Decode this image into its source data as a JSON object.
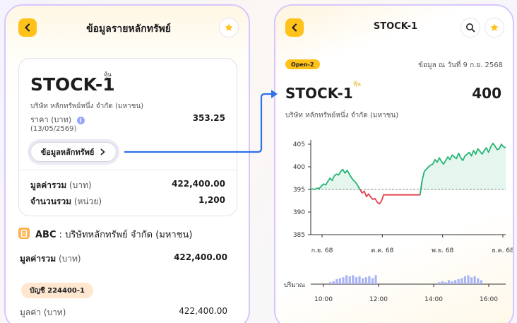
{
  "left_screen": {
    "title": "ข้อมูลรายหลักทรัพย์",
    "stock": {
      "symbol": "STOCK-1",
      "unit_sup": "หุ้น",
      "company": "บริษัท หลักทรัพย์หนึ่ง จำกัด (มหาชน)",
      "price_label": "ราคา (บาท)",
      "price_value": "353.25",
      "price_date": "(13/05/2569)",
      "info_button": "ข้อมูลหลักทรัพย์"
    },
    "totals": {
      "value_label_bold": "มูลค่ารวม",
      "value_label_unit": "(บาท)",
      "value": "422,400.00",
      "qty_label_bold": "จำนวนรวม",
      "qty_label_unit": "(หน่วย)",
      "qty": "1,200"
    },
    "broker": {
      "code": "ABC",
      "separator": ":",
      "name": "บริษัทหลักทรัพย์ จำกัด (มหาชน)",
      "value_label_bold": "มูลค่ารวม",
      "value_label_unit": "(บาท)",
      "value": "422,400.00"
    },
    "account": {
      "badge": "บัญชี 224400-1",
      "value_label": "มูลค่า (บาท)",
      "value": "422,400.00"
    }
  },
  "right_screen": {
    "title": "STOCK-1",
    "badge": "Open-2",
    "as_of": "ข้อมูล ณ วันที่ 9 ก.ย. 2568",
    "symbol": "STOCK-1",
    "unit_sup": "หุ้น",
    "price": "400",
    "company": "บริษัท หลักทรัพย์หนึ่ง จำกัด (มหาชน)",
    "volume_label": "ปริมาณ"
  },
  "icons": [
    "chevron-left-icon",
    "star-icon",
    "search-icon",
    "building-icon",
    "chevron-right-icon",
    "info-icon",
    "arrow-right-icon"
  ],
  "colors": {
    "accent_yellow": "#ffc21a",
    "up_green": "#22b573",
    "down_red": "#e5404f",
    "connector_blue": "#2f6fe8",
    "volume_bar": "#aab4f5"
  },
  "chart_data": {
    "type": "line",
    "ylim": [
      385,
      405
    ],
    "yticks": [
      "405",
      "400",
      "395",
      "390",
      "385"
    ],
    "xticks": [
      "ก.ย. 68",
      "ต.ค. 68",
      "พ.ย. 68",
      "ธ.ค. 68"
    ],
    "baseline": 395,
    "values": [
      395,
      395.1,
      395,
      395.3,
      395.2,
      395.8,
      396.2,
      396,
      396.8,
      397.5,
      397,
      398,
      398.4,
      398.2,
      399,
      399.4,
      398.6,
      399.2,
      398.4,
      397.6,
      397,
      396.5,
      395.8,
      395,
      394.2,
      394.6,
      393.4,
      394,
      393.3,
      392.8,
      393,
      392.2,
      391.8,
      392.4,
      393.8,
      393.8,
      393.8,
      393.8,
      393.8,
      393.8,
      393.8,
      393.8,
      393.8,
      393.8,
      393.8,
      393.8,
      393.8,
      393.8,
      393.8,
      393.8,
      393.8,
      393.8,
      397,
      399,
      399.5,
      400,
      400.4,
      400.6,
      401.6,
      401,
      402,
      401.2,
      400.6,
      401.4,
      402.2,
      401.6,
      402.6,
      402.2,
      401.8,
      403,
      402,
      401.4,
      402.4,
      402.8,
      403.2,
      402.4,
      403.6,
      402.8,
      404,
      403.4,
      402.8,
      403.6,
      404.2,
      403.2,
      404.4,
      405.2,
      404.6,
      403.8,
      404,
      405,
      404.4,
      404.2
    ],
    "volume": {
      "label": "ปริมาณ",
      "x_labels": [
        "10:00",
        "12:00",
        "14:00",
        "16:00"
      ],
      "bars_left": [
        2,
        3,
        5,
        6,
        7,
        9,
        8,
        9,
        7,
        8,
        6,
        7,
        8,
        6,
        9
      ],
      "bars_right": [
        2,
        3,
        2,
        4,
        3,
        4,
        5,
        6,
        8,
        9,
        7,
        8,
        6,
        4
      ]
    }
  }
}
